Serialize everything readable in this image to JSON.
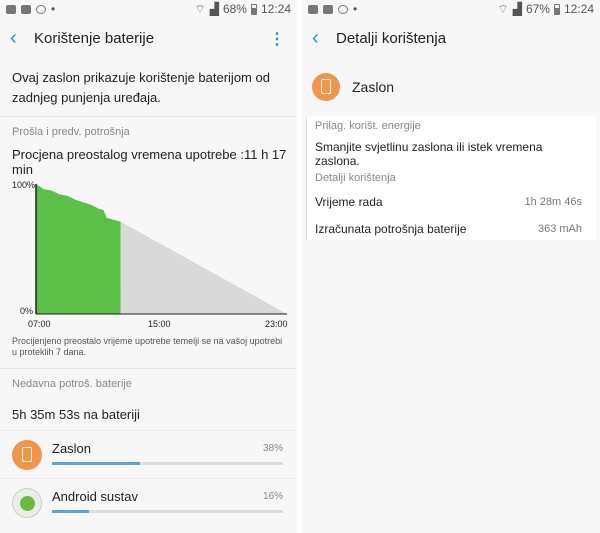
{
  "left": {
    "status": {
      "battery": "68%",
      "time": "12:24"
    },
    "title": "Korištenje baterije",
    "description": "Ovaj zaslon prikazuje korištenje baterijom od zadnjeg punjenja uređaja.",
    "section_usage": "Prošla i predv. potrošnja",
    "estimate": "Procjena preostalog vremena upotrebe :11 h 17 min",
    "note": "Procijenjeno preostalo vrijeme upotrebe temelji se na vašoj upotrebi u proteklih 7 dana.",
    "section_recent": "Nedavna potroš. baterije",
    "total": "5h 35m 53s na bateriji",
    "apps": [
      {
        "name": "Zaslon",
        "percent": "38%",
        "fraction": 0.38,
        "icon": "phone-settings-icon"
      },
      {
        "name": "Android sustav",
        "percent": "16%",
        "fraction": 0.16,
        "icon": "android-system-icon"
      }
    ]
  },
  "right": {
    "status": {
      "battery": "67%",
      "time": "12:24"
    },
    "title": "Detalji korištenja",
    "app_name": "Zaslon",
    "section_settings": "Prilag. korišt. energije",
    "tip": "Smanjite svjetlinu zaslona ili istek vremena zaslona.",
    "section_details": "Detalji korištenja",
    "details": [
      {
        "label": "Vrijeme rada",
        "value": "1h 28m 46s"
      },
      {
        "label": "Izračunata potrošnja baterije",
        "value": "363 mAh"
      }
    ]
  },
  "chart_data": {
    "type": "area",
    "y_ticks": [
      "100%",
      "0%"
    ],
    "x_ticks": [
      "07:00",
      "15:00",
      "23:00"
    ],
    "ylim": [
      0,
      100
    ],
    "series": [
      {
        "x": [
          7.0,
          7.5,
          8.0,
          8.5,
          9.0,
          9.5,
          10.0,
          10.5,
          11.0,
          11.3,
          11.5,
          12.4
        ],
        "values": [
          100,
          96,
          95,
          92,
          91,
          88,
          86,
          84,
          81,
          80,
          74,
          71
        ],
        "color": "#5cbf47"
      },
      {
        "x": [
          12.4,
          23.0
        ],
        "values": [
          71,
          0
        ],
        "color": "#d9d9d9"
      }
    ],
    "colors": {
      "measured": "#5cbf47",
      "predicted": "#d9d9d9"
    }
  }
}
